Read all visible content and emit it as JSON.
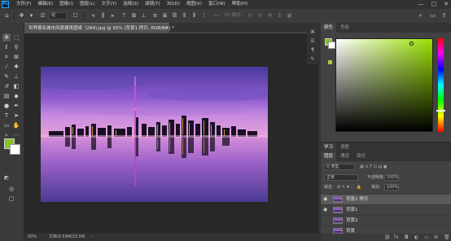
{
  "app": {
    "logo": "Ps"
  },
  "menu": [
    "文件(F)",
    "编辑(E)",
    "图像(I)",
    "图层(L)",
    "文字(Y)",
    "选择(S)",
    "滤镜(T)",
    "3D(D)",
    "视图(V)",
    "窗口(W)",
    "帮助(H)"
  ],
  "window_controls": {
    "minimize": "—",
    "maximize": "□",
    "close": "✕"
  },
  "options": {
    "auto_select_value": "组",
    "align_label": "3D 模式：",
    "dim": "#767676"
  },
  "document": {
    "tab_title": "世界著名城市风景建筑壁纸（284).jpg @ 50% (背景1 拷贝, RGB/8#) *",
    "close": "×"
  },
  "status": {
    "zoom": "50%",
    "doc_size": "文档:6.59M/23.5M"
  },
  "colors": {
    "foreground": "#8bbf2a",
    "background": "#ffffff"
  },
  "color_panel": {
    "tabs": [
      "颜色",
      "色板"
    ]
  },
  "adjust_panel": {
    "tabs": [
      "学习",
      "调整"
    ]
  },
  "layers_panel": {
    "tabs": [
      "图层",
      "通道",
      "路径"
    ],
    "filter_label": "Q 类型",
    "blend_mode": "正常",
    "opacity_label": "不透明度:",
    "opacity_value": "100%",
    "lock_label": "锁定:",
    "fill_label": "填充:",
    "fill_value": "100%",
    "layers": [
      {
        "name": "背景1 拷贝",
        "visible": true,
        "selected": true
      },
      {
        "name": "背景1",
        "visible": true,
        "selected": false
      },
      {
        "name": "背景2",
        "visible": false,
        "selected": false
      },
      {
        "name": "背景",
        "visible": false,
        "selected": false
      }
    ]
  },
  "icons": {
    "move": "move-icon",
    "marquee": "marquee-icon",
    "lasso": "lasso-icon",
    "crop": "crop-icon",
    "brush": "brush-icon",
    "eye": "eye-icon",
    "home": "home-icon",
    "search": "search-icon"
  }
}
